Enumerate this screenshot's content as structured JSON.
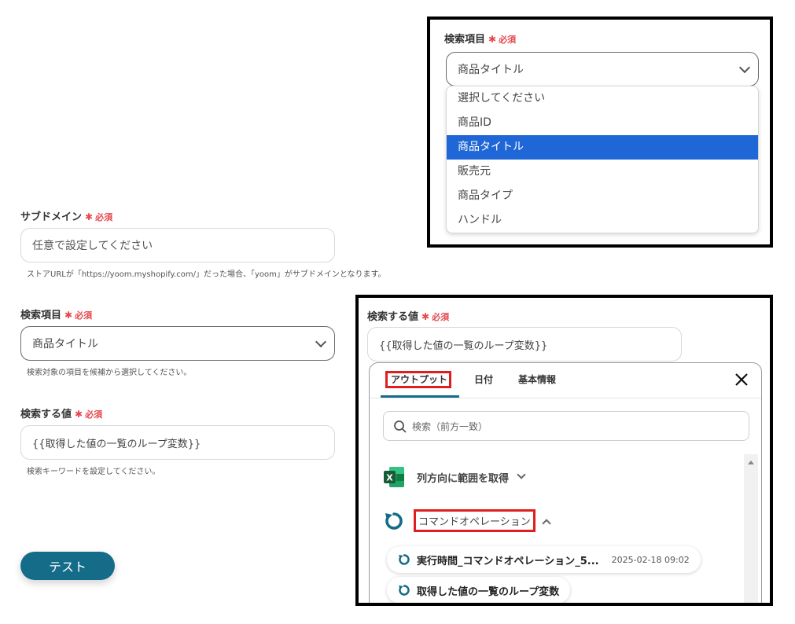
{
  "required_label": "必須",
  "subdomain": {
    "label": "サブドメイン",
    "placeholder": "任意で設定してください",
    "hint": "ストアURLが「https://yoom.myshopify.com/」だった場合、「yoom」がサブドメインとなります。"
  },
  "search_field": {
    "label": "検索項目",
    "value": "商品タイトル",
    "hint": "検索対象の項目を候補から選択してください。"
  },
  "search_value": {
    "label": "検索する値",
    "value": "{{取得した値の一覧のループ変数}}",
    "hint": "検索キーワードを設定してください。"
  },
  "test_button": "テスト",
  "dropdown_panel": {
    "label": "検索項目",
    "value": "商品タイトル",
    "options": [
      "選択してください",
      "商品ID",
      "商品タイトル",
      "販売元",
      "商品タイプ",
      "ハンドル"
    ],
    "selected_index": 2
  },
  "value_panel": {
    "label": "検索する値",
    "value": "{{取得した値の一覧のループ変数}}",
    "tabs": [
      "アウトプット",
      "日付",
      "基本情報"
    ],
    "active_tab": 0,
    "search_placeholder": "検索（前方一致）",
    "groups": [
      {
        "label": "列方向に範囲を取得",
        "icon": "excel-icon",
        "expanded": false
      },
      {
        "label": "コマンドオペレーション",
        "icon": "refresh-icon",
        "expanded": true
      }
    ],
    "items": [
      {
        "label": "実行時間_コマンドオペレーション_5...",
        "time": "2025-02-18 09:02"
      },
      {
        "label": "取得した値の一覧のループ変数",
        "time": ""
      }
    ]
  },
  "colors": {
    "accent": "#146c88",
    "required": "#e5484d",
    "selected": "#1f66d6",
    "highlight": "#e01e1e"
  }
}
